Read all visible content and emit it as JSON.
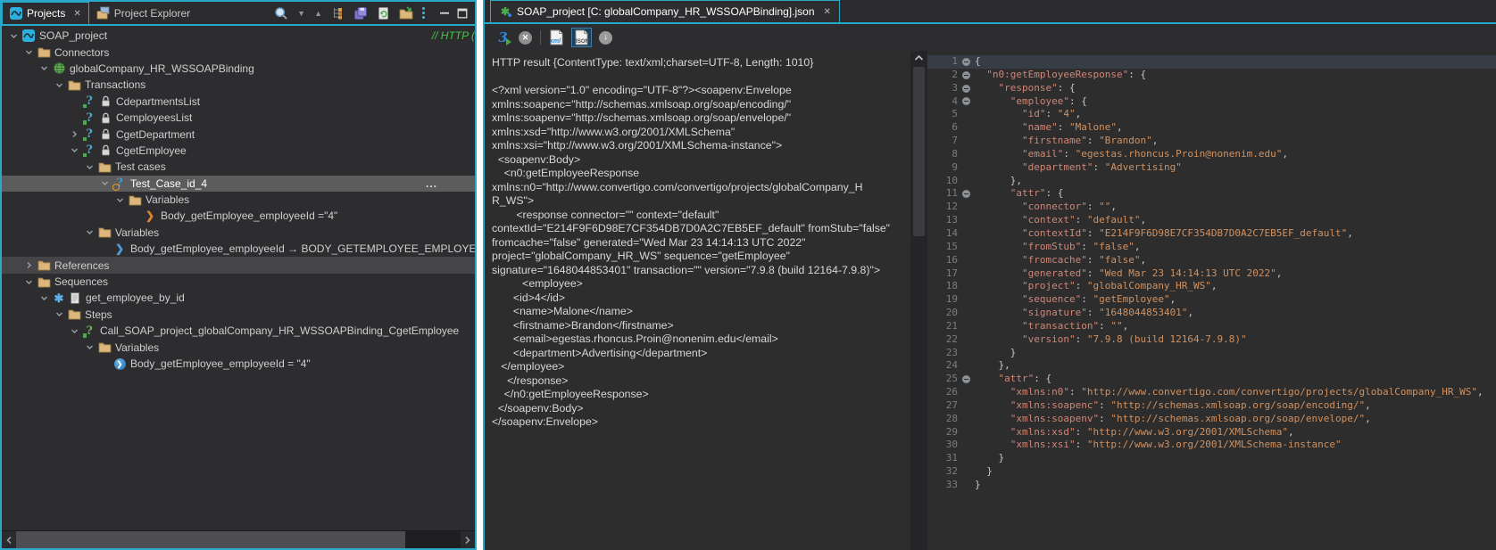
{
  "colors": {
    "accent": "#29a9c9",
    "panel_bg": "#2d2d30",
    "editor_bg": "#2d2d2d",
    "selection": "#5c5c5c",
    "json_key": "#cf8677",
    "json_value": "#cf9162",
    "project_comment": "#43c843"
  },
  "left_panel": {
    "tabs": [
      {
        "label": "Projects",
        "icon": "project",
        "active": true,
        "closable": true
      },
      {
        "label": "Project Explorer",
        "icon": "explorer",
        "active": false
      }
    ],
    "toolbar": [
      {
        "name": "search"
      },
      {
        "name": "collapse-down"
      },
      {
        "name": "collapse-up"
      },
      {
        "name": "link-editor"
      },
      {
        "name": "save-all"
      },
      {
        "name": "refresh"
      },
      {
        "name": "import-project"
      },
      {
        "name": "view-menu"
      }
    ],
    "window_buttons": [
      {
        "name": "minimize"
      },
      {
        "name": "maximize"
      }
    ],
    "tree": [
      {
        "level": 0,
        "chevron": "expanded",
        "icons": [
          "project"
        ],
        "label": "SOAP_project",
        "suffix": "// HTTP ("
      },
      {
        "level": 1,
        "chevron": "expanded",
        "icons": [
          "folder"
        ],
        "label": "Connectors"
      },
      {
        "level": 2,
        "chevron": "expanded",
        "icons": [
          "globe"
        ],
        "label": "globalCompany_HR_WSSOAPBinding"
      },
      {
        "level": 3,
        "chevron": "expanded",
        "icons": [
          "folder"
        ],
        "label": "Transactions"
      },
      {
        "level": 4,
        "chevron": "none",
        "icons": [
          "transaction",
          "lock"
        ],
        "label": "CdepartmentsList"
      },
      {
        "level": 4,
        "chevron": "none",
        "icons": [
          "transaction",
          "lock"
        ],
        "label": "CemployeesList"
      },
      {
        "level": 4,
        "chevron": "collapsed",
        "icons": [
          "transaction",
          "lock"
        ],
        "label": "CgetDepartment"
      },
      {
        "level": 4,
        "chevron": "expanded",
        "icons": [
          "transaction",
          "lock"
        ],
        "label": "CgetEmployee"
      },
      {
        "level": 5,
        "chevron": "expanded",
        "icons": [
          "folder"
        ],
        "label": "Test cases"
      },
      {
        "level": 6,
        "chevron": "expanded",
        "icons": [
          "testcase"
        ],
        "label": "Test_Case_id_4",
        "selected": true,
        "trailing": "..."
      },
      {
        "level": 7,
        "chevron": "expanded",
        "icons": [
          "folder"
        ],
        "label": "Variables"
      },
      {
        "level": 8,
        "chevron": "none",
        "icons": [
          "var-orange"
        ],
        "label": "Body_getEmployee_employeeId =\"4\""
      },
      {
        "level": 5,
        "chevron": "expanded",
        "icons": [
          "folder"
        ],
        "label": "Variables"
      },
      {
        "level": 6,
        "chevron": "none",
        "icons": [
          "var-blue"
        ],
        "label": "Body_getEmployee_employeeId → BODY_GETEMPLOYEE_EMPLOYEEID"
      },
      {
        "level": 1,
        "chevron": "collapsed",
        "icons": [
          "folder"
        ],
        "label": "References",
        "highlighted": true
      },
      {
        "level": 1,
        "chevron": "expanded",
        "icons": [
          "folder"
        ],
        "label": "Sequences"
      },
      {
        "level": 2,
        "chevron": "expanded",
        "icons": [
          "sequence",
          "doc"
        ],
        "label": "get_employee_by_id"
      },
      {
        "level": 3,
        "chevron": "expanded",
        "icons": [
          "folder"
        ],
        "label": "Steps"
      },
      {
        "level": 4,
        "chevron": "expanded",
        "icons": [
          "call-step"
        ],
        "label": "Call_SOAP_project_globalCompany_HR_WSSOAPBinding_CgetEmployee"
      },
      {
        "level": 5,
        "chevron": "expanded",
        "icons": [
          "folder"
        ],
        "label": "Variables"
      },
      {
        "level": 6,
        "chevron": "none",
        "icons": [
          "var-circle"
        ],
        "label": "Body_getEmployee_employeeId = \"4\""
      }
    ]
  },
  "editor": {
    "tab": {
      "icon": "editor-tab",
      "label": "SOAP_project [C: globalCompany_HR_WSSOAPBinding].json",
      "closable": true
    },
    "toolbar": [
      {
        "name": "execute",
        "icon": "run",
        "selected": false
      },
      {
        "name": "stop",
        "icon": "stop",
        "selected": false
      },
      {
        "name": "separator"
      },
      {
        "name": "xml-view",
        "icon": "xml-doc",
        "selected": false
      },
      {
        "name": "json-view",
        "icon": "json-doc",
        "selected": true
      },
      {
        "name": "save-response",
        "icon": "download",
        "selected": false
      }
    ],
    "xml_pane": {
      "lines": [
        "HTTP result {ContentType: text/xml;charset=UTF-8, Length: 1010}",
        "",
        "<?xml version=\"1.0\" encoding=\"UTF-8\"?><soapenv:Envelope",
        "xmlns:soapenc=\"http://schemas.xmlsoap.org/soap/encoding/\"",
        "xmlns:soapenv=\"http://schemas.xmlsoap.org/soap/envelope/\"",
        "xmlns:xsd=\"http://www.w3.org/2001/XMLSchema\"",
        "xmlns:xsi=\"http://www.w3.org/2001/XMLSchema-instance\">",
        "  <soapenv:Body>",
        "    <n0:getEmployeeResponse",
        "xmlns:n0=\"http://www.convertigo.com/convertigo/projects/globalCompany_H",
        "R_WS\">",
        "        <response connector=\"\" context=\"default\"",
        "contextId=\"E214F9F6D98E7CF354DB7D0A2C7EB5EF_default\" fromStub=\"false\"",
        "fromcache=\"false\" generated=\"Wed Mar 23 14:14:13 UTC 2022\"",
        "project=\"globalCompany_HR_WS\" sequence=\"getEmployee\"",
        "signature=\"1648044853401\" transaction=\"\" version=\"7.9.8 (build 12164-7.9.8)\">",
        "          <employee>",
        "       <id>4</id>",
        "       <name>Malone</name>",
        "       <firstname>Brandon</firstname>",
        "       <email>egestas.rhoncus.Proin@nonenim.edu</email>",
        "       <department>Advertising</department>",
        "   </employee>",
        "     </response>",
        "    </n0:getEmployeeResponse>",
        "  </soapenv:Body>",
        "</soapenv:Envelope>"
      ]
    },
    "json_pane": {
      "current_line": 1,
      "lines": [
        {
          "n": 1,
          "fold": true,
          "text": "{"
        },
        {
          "n": 2,
          "fold": true,
          "text": "  \"n0:getEmployeeResponse\": {"
        },
        {
          "n": 3,
          "fold": true,
          "text": "    \"response\": {"
        },
        {
          "n": 4,
          "fold": true,
          "text": "      \"employee\": {"
        },
        {
          "n": 5,
          "text": "        \"id\": \"4\","
        },
        {
          "n": 6,
          "text": "        \"name\": \"Malone\","
        },
        {
          "n": 7,
          "text": "        \"firstname\": \"Brandon\","
        },
        {
          "n": 8,
          "text": "        \"email\": \"egestas.rhoncus.Proin@nonenim.edu\","
        },
        {
          "n": 9,
          "text": "        \"department\": \"Advertising\""
        },
        {
          "n": 10,
          "text": "      },"
        },
        {
          "n": 11,
          "fold": true,
          "text": "      \"attr\": {"
        },
        {
          "n": 12,
          "text": "        \"connector\": \"\","
        },
        {
          "n": 13,
          "text": "        \"context\": \"default\","
        },
        {
          "n": 14,
          "text": "        \"contextId\": \"E214F9F6D98E7CF354DB7D0A2C7EB5EF_default\","
        },
        {
          "n": 15,
          "text": "        \"fromStub\": \"false\","
        },
        {
          "n": 16,
          "text": "        \"fromcache\": \"false\","
        },
        {
          "n": 17,
          "text": "        \"generated\": \"Wed Mar 23 14:14:13 UTC 2022\","
        },
        {
          "n": 18,
          "text": "        \"project\": \"globalCompany_HR_WS\","
        },
        {
          "n": 19,
          "text": "        \"sequence\": \"getEmployee\","
        },
        {
          "n": 20,
          "text": "        \"signature\": \"1648044853401\","
        },
        {
          "n": 21,
          "text": "        \"transaction\": \"\","
        },
        {
          "n": 22,
          "text": "        \"version\": \"7.9.8 (build 12164-7.9.8)\""
        },
        {
          "n": 23,
          "text": "      }"
        },
        {
          "n": 24,
          "text": "    },"
        },
        {
          "n": 25,
          "fold": true,
          "text": "    \"attr\": {"
        },
        {
          "n": 26,
          "text": "      \"xmlns:n0\": \"http://www.convertigo.com/convertigo/projects/globalCompany_HR_WS\","
        },
        {
          "n": 27,
          "text": "      \"xmlns:soapenc\": \"http://schemas.xmlsoap.org/soap/encoding/\","
        },
        {
          "n": 28,
          "text": "      \"xmlns:soapenv\": \"http://schemas.xmlsoap.org/soap/envelope/\","
        },
        {
          "n": 29,
          "text": "      \"xmlns:xsd\": \"http://www.w3.org/2001/XMLSchema\","
        },
        {
          "n": 30,
          "text": "      \"xmlns:xsi\": \"http://www.w3.org/2001/XMLSchema-instance\""
        },
        {
          "n": 31,
          "text": "    }"
        },
        {
          "n": 32,
          "text": "  }"
        },
        {
          "n": 33,
          "text": "}"
        }
      ]
    }
  }
}
